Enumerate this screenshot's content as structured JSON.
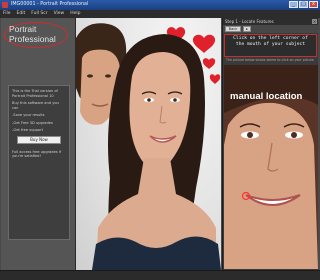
{
  "window": {
    "title": "IMG00001 - Portrait Professional",
    "minimize": "_",
    "maximize": "□",
    "close": "x"
  },
  "menu": [
    "File",
    "Edit",
    "Full Scr",
    "View",
    "Help"
  ],
  "left_panel": {
    "logo_line1": "Portrait",
    "logo_line2": "Professional",
    "info": {
      "intro": "This is the Trial version of Portrait Professional 10",
      "features_heading": "Buy this software and you can",
      "feature1": "-Save your results",
      "feature2": "-Get Free 3D upgrades",
      "feature3": "-Get free support",
      "buy_label": "Buy Now",
      "footer": "Full access free upgrades if you're satisfied!"
    }
  },
  "right_panel": {
    "step_title": "Step 1 - Locate Features",
    "back_label": "Back",
    "next_label": "▸",
    "instruction": "Click on the left corner of the mouth of your subject",
    "hint": "The picture below shows where to click on your picture",
    "manual_label": "manual location"
  },
  "colors": {
    "accent_red": "#d62a2a",
    "titlebar": "#2a5aa8",
    "panel": "#555555"
  }
}
